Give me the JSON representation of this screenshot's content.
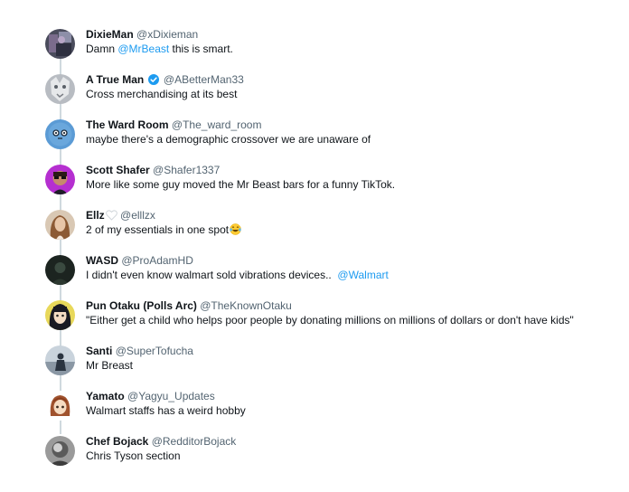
{
  "replies": [
    {
      "name": "DixieMan",
      "handle": "@xDixieman",
      "text_before": "Damn ",
      "mention": "@MrBeast",
      "text_after": " this is smart."
    },
    {
      "name": "A True Man",
      "handle": "@ABetterMan33",
      "verified": true,
      "text": "Cross merchandising at its best"
    },
    {
      "name": "The Ward Room",
      "handle": "@The_ward_room",
      "text": "maybe there's a demographic crossover we are unaware of"
    },
    {
      "name": "Scott Shafer",
      "handle": "@Shafer1337",
      "text": "More like some guy moved the Mr Beast bars for a funny TikTok."
    },
    {
      "name": "Ellz",
      "name_emoji": "white-heart-icon",
      "handle": "@elllzx",
      "text": "2 of my essentials in one spot",
      "text_emoji": "laughing-tears-emoji-icon"
    },
    {
      "name": "WASD",
      "handle": "@ProAdamHD",
      "text": "I didn't even know walmart sold vibrations devices..  ",
      "mention": "@Walmart"
    },
    {
      "name": "Pun Otaku (Polls Arc)",
      "handle": "@TheKnownOtaku",
      "text": "\"Either get a child who helps poor people by donating millions on millions of dollars or don't have kids\""
    },
    {
      "name": "Santi",
      "handle": "@SuperTofucha",
      "text": "Mr Breast"
    },
    {
      "name": "Yamato",
      "handle": "@Yagyu_Updates",
      "text": "Walmart staffs has a weird hobby"
    },
    {
      "name": "Chef Bojack",
      "handle": "@RedditorBojack",
      "text": "Chris Tyson section"
    }
  ],
  "colors": {
    "text": "#0f1419",
    "handle": "#536471",
    "mention": "#1d9bf0",
    "verified": "#1d9bf0",
    "connector": "#cfd9de"
  }
}
